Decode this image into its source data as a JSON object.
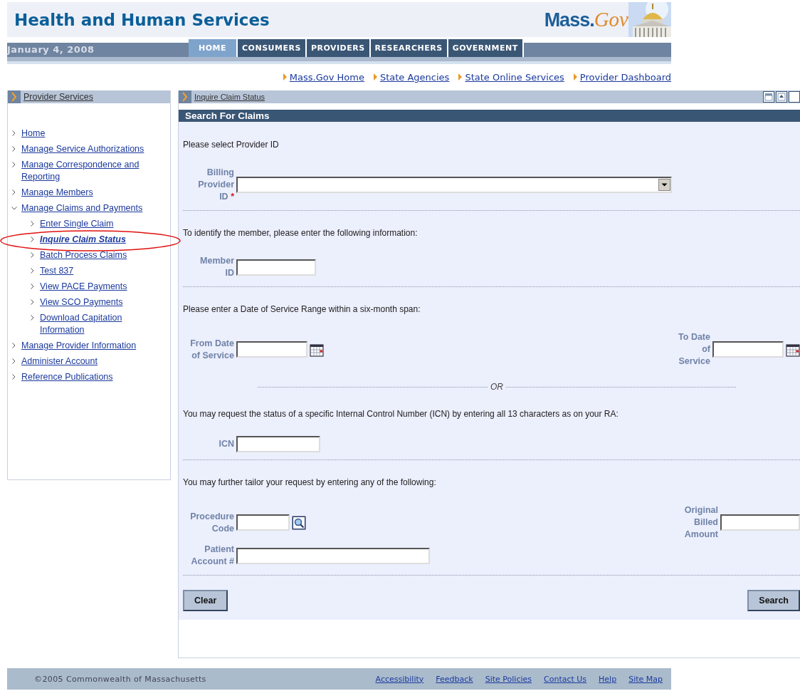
{
  "header": {
    "title": "Health and Human Services",
    "logo_parts": [
      "Mass.",
      "Gov"
    ],
    "date": "January 4, 2008"
  },
  "tabs": [
    {
      "label": "HOME",
      "selected": true
    },
    {
      "label": "CONSUMERS",
      "selected": false
    },
    {
      "label": "PROVIDERS",
      "selected": false
    },
    {
      "label": "RESEARCHERS",
      "selected": false
    },
    {
      "label": "GOVERNMENT",
      "selected": false
    }
  ],
  "top_links": [
    "Mass.Gov Home",
    "State Agencies",
    "State Online Services",
    "Provider Dashboard"
  ],
  "sidebar": {
    "title": "Provider Services",
    "items": [
      {
        "label": "Home",
        "expanded": false,
        "selected": false
      },
      {
        "label": "Manage Service Authorizations",
        "expanded": false,
        "selected": false
      },
      {
        "label": "Manage Correspondence and Reporting",
        "expanded": false,
        "selected": false
      },
      {
        "label": "Manage Members",
        "expanded": false,
        "selected": false
      },
      {
        "label": "Manage Claims and Payments",
        "expanded": true,
        "selected": false,
        "children": [
          {
            "label": "Enter Single Claim",
            "selected": false
          },
          {
            "label": "Inquire Claim Status",
            "selected": true
          },
          {
            "label": "Batch Process Claims",
            "selected": false
          },
          {
            "label": "Test 837",
            "selected": false
          },
          {
            "label": "View PACE Payments",
            "selected": false
          },
          {
            "label": "View SCO Payments",
            "selected": false
          },
          {
            "label": "Download Capitation Information",
            "selected": false
          }
        ]
      },
      {
        "label": "Manage Provider Information",
        "expanded": false,
        "selected": false
      },
      {
        "label": "Administer Account",
        "expanded": false,
        "selected": false
      },
      {
        "label": "Reference Publications",
        "expanded": false,
        "selected": false
      }
    ]
  },
  "annotations": [
    {
      "kind": "ellipse"
    }
  ],
  "main": {
    "breadcrumb": "Inquire Claim Status",
    "panel_title": "Search For Claims",
    "sections": [
      {
        "kind": "form",
        "instruction": "Please select Provider ID",
        "rows": [
          {
            "fields": [
              {
                "kind": "select",
                "label_lines": [
                  "Billing",
                  "Provider",
                  "ID"
                ],
                "required_mark": "*"
              }
            ]
          }
        ]
      },
      {
        "kind": "form",
        "instruction": "To identify the member, please enter the following information:",
        "rows": [
          {
            "fields": [
              {
                "kind": "text",
                "label_lines": [
                  "Member",
                  "ID"
                ]
              }
            ]
          }
        ]
      },
      {
        "kind": "form",
        "instruction": "Please enter a Date of Service Range within a six-month span:",
        "rows": [
          {
            "fields": [
              {
                "kind": "date",
                "label_lines": [
                  "From Date",
                  "of Service"
                ]
              },
              {
                "kind": "date",
                "label_lines": [
                  "To Date",
                  "of",
                  "Service"
                ]
              }
            ]
          }
        ]
      },
      {
        "kind": "or",
        "text": "OR"
      },
      {
        "kind": "form",
        "instruction": "You may request the status of a specific Internal Control Number (ICN) by entering all 13 characters as on your RA:",
        "rows": [
          {
            "fields": [
              {
                "kind": "text",
                "label_lines": [
                  "ICN"
                ]
              }
            ]
          }
        ]
      },
      {
        "kind": "form",
        "instruction": "You may further tailor your request by entering any of the following:",
        "rows": [
          {
            "fields": [
              {
                "kind": "lookup",
                "label_lines": [
                  "Procedure",
                  "Code"
                ]
              },
              {
                "kind": "text",
                "label_lines": [
                  "Original",
                  "Billed",
                  "Amount"
                ]
              }
            ]
          },
          {
            "fields": [
              {
                "kind": "text",
                "label_lines": [
                  "Patient",
                  "Account #"
                ]
              }
            ]
          }
        ]
      }
    ],
    "buttons": [
      "Clear",
      "Search"
    ]
  },
  "footer": {
    "copyright": "©2005 Commonwealth of Massachusetts",
    "links": [
      "Accessibility",
      "Feedback",
      "Site Policies",
      "Contact Us",
      "Help",
      "Site Map"
    ]
  }
}
